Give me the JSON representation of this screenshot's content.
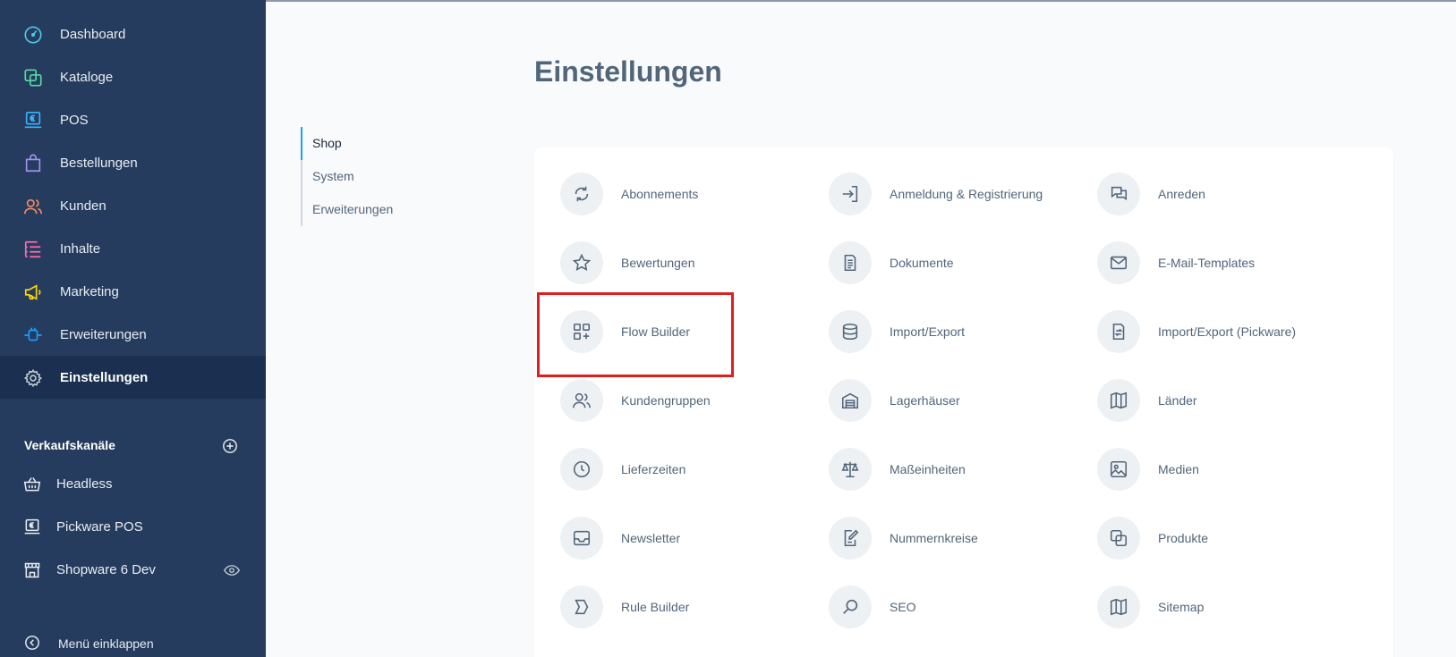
{
  "sidebar": {
    "nav": [
      {
        "label": "Dashboard",
        "icon": "gauge-icon",
        "color": "#4bcbe8"
      },
      {
        "label": "Kataloge",
        "icon": "copy-icon",
        "color": "#57d9a3"
      },
      {
        "label": "POS",
        "icon": "pos-terminal-icon",
        "color": "#37b3ff"
      },
      {
        "label": "Bestellungen",
        "icon": "shopping-bag-icon",
        "color": "#a092f0"
      },
      {
        "label": "Kunden",
        "icon": "users-icon",
        "color": "#f88962"
      },
      {
        "label": "Inhalte",
        "icon": "content-list-icon",
        "color": "#ff68ac"
      },
      {
        "label": "Marketing",
        "icon": "megaphone-icon",
        "color": "#ffd700"
      },
      {
        "label": "Erweiterungen",
        "icon": "plug-icon",
        "color": "#189eff"
      },
      {
        "label": "Einstellungen",
        "icon": "gear-icon",
        "color": "#c3ccd5"
      }
    ],
    "sales_channels": {
      "title": "Verkaufskanäle",
      "items": [
        {
          "label": "Headless",
          "icon": "basket-icon"
        },
        {
          "label": "Pickware POS",
          "icon": "pos-terminal-icon"
        },
        {
          "label": "Shopware 6 Dev",
          "icon": "storefront-icon"
        }
      ]
    },
    "collapse_label": "Menü einklappen"
  },
  "page": {
    "title": "Einstellungen"
  },
  "subnav": [
    {
      "label": "Shop"
    },
    {
      "label": "System"
    },
    {
      "label": "Erweiterungen"
    }
  ],
  "settings": [
    {
      "label": "Abonnements",
      "icon": "refresh-icon"
    },
    {
      "label": "Anmeldung & Registrierung",
      "icon": "sign-in-icon"
    },
    {
      "label": "Anreden",
      "icon": "chat-bubbles-icon"
    },
    {
      "label": "Bewertungen",
      "icon": "star-icon"
    },
    {
      "label": "Dokumente",
      "icon": "document-icon"
    },
    {
      "label": "E-Mail-Templates",
      "icon": "envelope-icon"
    },
    {
      "label": "Flow Builder",
      "icon": "flow-builder-icon"
    },
    {
      "label": "Import/Export",
      "icon": "database-icon"
    },
    {
      "label": "Import/Export (Pickware)",
      "icon": "file-transfer-icon"
    },
    {
      "label": "Kundengruppen",
      "icon": "users-icon"
    },
    {
      "label": "Lagerhäuser",
      "icon": "warehouse-icon"
    },
    {
      "label": "Länder",
      "icon": "map-icon"
    },
    {
      "label": "Lieferzeiten",
      "icon": "clock-icon"
    },
    {
      "label": "Maßeinheiten",
      "icon": "scale-icon"
    },
    {
      "label": "Medien",
      "icon": "image-icon"
    },
    {
      "label": "Newsletter",
      "icon": "inbox-icon"
    },
    {
      "label": "Nummernkreise",
      "icon": "edit-document-icon"
    },
    {
      "label": "Produkte",
      "icon": "copy-icon"
    },
    {
      "label": "Rule Builder",
      "icon": "rule-icon"
    },
    {
      "label": "SEO",
      "icon": "search-icon"
    },
    {
      "label": "Sitemap",
      "icon": "map-icon"
    }
  ]
}
